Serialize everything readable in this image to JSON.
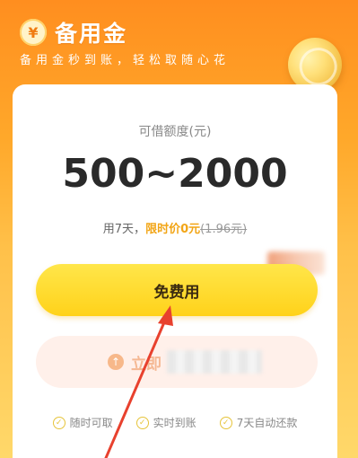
{
  "header": {
    "brand_icon": "¥",
    "title": "备用金",
    "slogan": "备用金秒到账，轻松取随心花"
  },
  "card": {
    "quota_label": "可借额度(元)",
    "quota_amount": "500~2000",
    "fee": {
      "prefix": "用7天，",
      "highlight": "限时价0元",
      "original": "(1.96元)"
    },
    "primary_button": "免费用",
    "secondary_button": {
      "icon": "up-arrow-icon",
      "label": "立即"
    },
    "features": [
      "随时可取",
      "实时到账",
      "7天自动还款"
    ]
  },
  "colors": {
    "accent": "#ffd21a",
    "highlight": "#f2a516",
    "arrow": "#e8412e"
  }
}
